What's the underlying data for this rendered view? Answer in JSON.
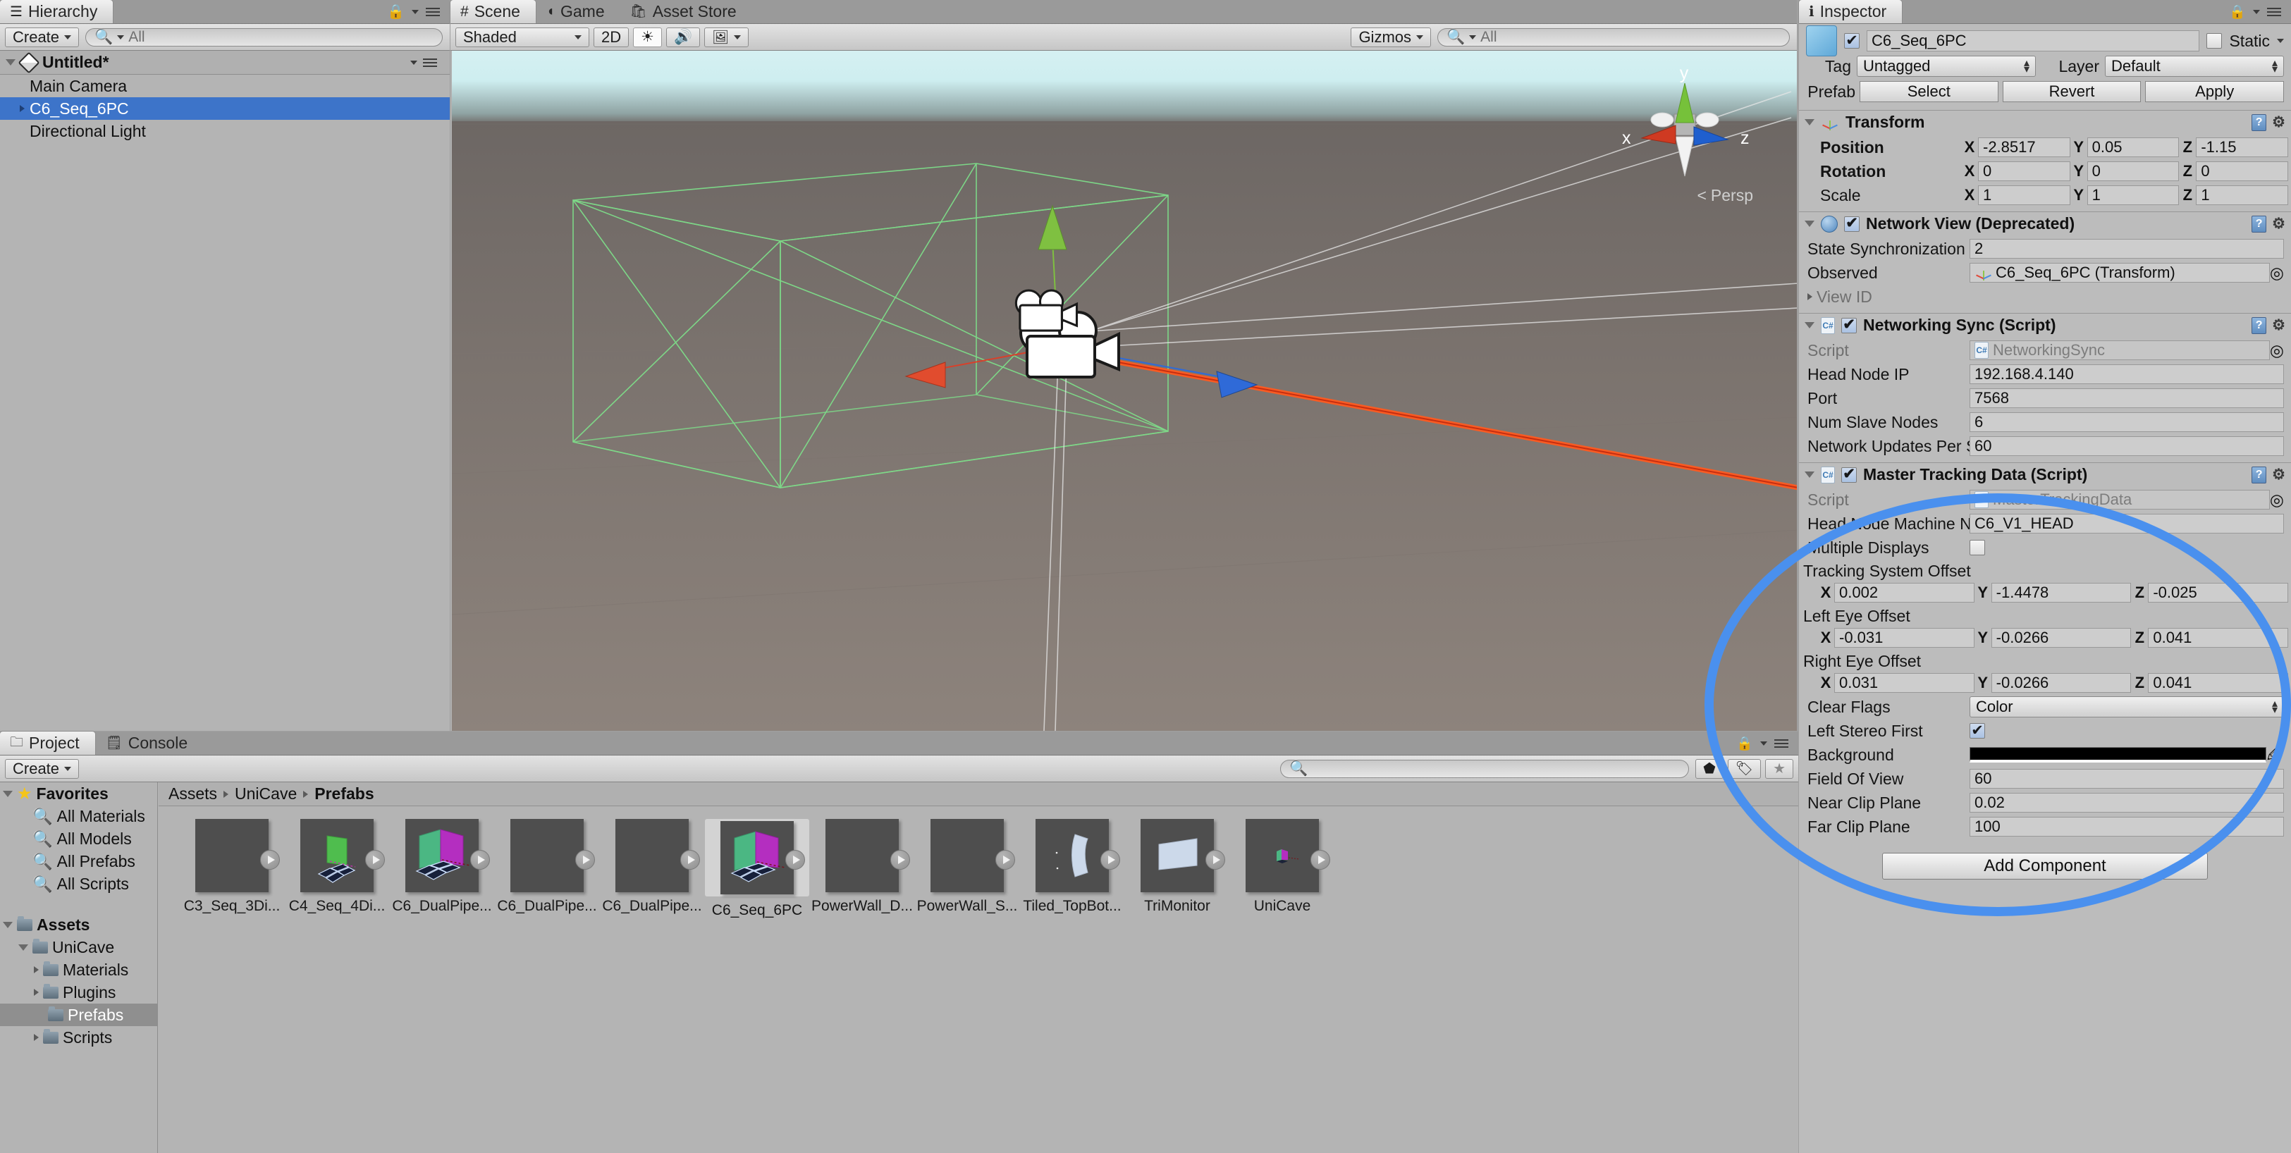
{
  "hierarchy": {
    "tab": "Hierarchy",
    "create_label": "Create",
    "search_placeholder": "All",
    "scene_name": "Untitled*",
    "items": [
      {
        "label": "Main Camera",
        "selected": false,
        "expandable": false
      },
      {
        "label": "C6_Seq_6PC",
        "selected": true,
        "expandable": true
      },
      {
        "label": "Directional Light",
        "selected": false,
        "expandable": false
      }
    ]
  },
  "sceneview": {
    "tabs": [
      {
        "label": "Scene",
        "icon": "grid-icon",
        "active": true
      },
      {
        "label": "Game",
        "icon": "gamepad-icon",
        "active": false
      },
      {
        "label": "Asset Store",
        "icon": "store-icon",
        "active": false
      }
    ],
    "draw_mode": "Shaded",
    "two_d_label": "2D",
    "lighting_icon": "sun-icon",
    "audio_icon": "speaker-icon",
    "effects_icon": "image-icon",
    "gizmos_label": "Gizmos",
    "search_placeholder": "All",
    "axis_labels": {
      "x": "x",
      "y": "y",
      "z": "z"
    },
    "projection_label": "Persp"
  },
  "project": {
    "tabs": [
      {
        "label": "Project",
        "icon": "folder-icon",
        "active": true
      },
      {
        "label": "Console",
        "icon": "console-icon",
        "active": false
      }
    ],
    "create_label": "Create",
    "search_placeholder": "",
    "breadcrumb": [
      "Assets",
      "UniCave",
      "Prefabs"
    ],
    "tree": [
      {
        "label": "Favorites",
        "icon": "star-icon",
        "depth": 0,
        "bold": true,
        "expanded": true,
        "selected": false
      },
      {
        "label": "All Materials",
        "icon": "search-icon",
        "depth": 1,
        "bold": false,
        "selected": false
      },
      {
        "label": "All Models",
        "icon": "search-icon",
        "depth": 1,
        "bold": false,
        "selected": false
      },
      {
        "label": "All Prefabs",
        "icon": "search-icon",
        "depth": 1,
        "bold": false,
        "selected": false
      },
      {
        "label": "All Scripts",
        "icon": "search-icon",
        "depth": 1,
        "bold": false,
        "selected": false
      },
      {
        "label": "",
        "icon": "",
        "depth": 0,
        "spacer": true
      },
      {
        "label": "Assets",
        "icon": "folder-icon",
        "depth": 0,
        "bold": true,
        "expanded": true,
        "selected": false
      },
      {
        "label": "UniCave",
        "icon": "folder-icon",
        "depth": 1,
        "bold": false,
        "expanded": true,
        "selected": false
      },
      {
        "label": "Materials",
        "icon": "folder-icon",
        "depth": 2,
        "bold": false,
        "expandable": true,
        "selected": false
      },
      {
        "label": "Plugins",
        "icon": "folder-icon",
        "depth": 2,
        "bold": false,
        "expandable": true,
        "selected": false
      },
      {
        "label": "Prefabs",
        "icon": "folder-icon",
        "depth": 2,
        "bold": false,
        "expandable": false,
        "selected": true
      },
      {
        "label": "Scripts",
        "icon": "folder-icon",
        "depth": 2,
        "bold": false,
        "expandable": true,
        "selected": false
      }
    ],
    "assets": [
      {
        "label": "C3_Seq_3Di...",
        "thumb": "empty",
        "selected": false
      },
      {
        "label": "C4_Seq_4Di...",
        "thumb": "green-wall",
        "selected": false
      },
      {
        "label": "C6_DualPipe...",
        "thumb": "green-magenta-cave",
        "selected": false
      },
      {
        "label": "C6_DualPipe...",
        "thumb": "empty",
        "selected": false
      },
      {
        "label": "C6_DualPipe...",
        "thumb": "empty",
        "selected": false
      },
      {
        "label": "C6_Seq_6PC",
        "thumb": "green-magenta-cave",
        "selected": true
      },
      {
        "label": "PowerWall_D...",
        "thumb": "empty",
        "selected": false
      },
      {
        "label": "PowerWall_S...",
        "thumb": "empty",
        "selected": false
      },
      {
        "label": "Tiled_TopBot...",
        "thumb": "curved-panel",
        "selected": false
      },
      {
        "label": "TriMonitor",
        "thumb": "flat-panel",
        "selected": false
      },
      {
        "label": "UniCave",
        "thumb": "small-cave",
        "selected": false
      }
    ]
  },
  "inspector": {
    "tab": "Inspector",
    "object_name": "C6_Seq_6PC",
    "object_enabled": true,
    "static_label": "Static",
    "static_checked": false,
    "tag_label": "Tag",
    "tag_value": "Untagged",
    "layer_label": "Layer",
    "layer_value": "Default",
    "prefab_label": "Prefab",
    "prefab_buttons": [
      "Select",
      "Revert",
      "Apply"
    ],
    "components": [
      {
        "name": "Transform",
        "icon": "transform-axis-icon",
        "has_checkbox": false,
        "vectors": [
          {
            "label": "Position",
            "bold": true,
            "x": "-2.8517",
            "y": "0.05",
            "z": "-1.15"
          },
          {
            "label": "Rotation",
            "bold": true,
            "x": "0",
            "y": "0",
            "z": "0"
          },
          {
            "label": "Scale",
            "bold": false,
            "x": "1",
            "y": "1",
            "z": "1"
          }
        ]
      },
      {
        "name": "Network View (Deprecated)",
        "icon": "network-globe-icon",
        "has_checkbox": true,
        "checked": true,
        "fields": [
          {
            "label": "State Synchronization",
            "value": "2",
            "type": "text"
          },
          {
            "label": "Observed",
            "value": "C6_Seq_6PC (Transform)",
            "type": "object",
            "picker": true
          },
          {
            "label": "View ID",
            "value": "",
            "type": "foldout"
          }
        ]
      },
      {
        "name": "Networking Sync (Script)",
        "icon": "csharp-script-icon",
        "has_checkbox": true,
        "checked": true,
        "fields": [
          {
            "label": "Script",
            "value": "NetworkingSync",
            "type": "script",
            "dim": true,
            "picker": true
          },
          {
            "label": "Head Node IP",
            "value": "192.168.4.140",
            "type": "text"
          },
          {
            "label": "Port",
            "value": "7568",
            "type": "text"
          },
          {
            "label": "Num Slave Nodes",
            "value": "6",
            "type": "text"
          },
          {
            "label": "Network Updates Per S",
            "value": "60",
            "type": "text"
          }
        ]
      },
      {
        "name": "Master Tracking Data (Script)",
        "icon": "csharp-script-icon",
        "has_checkbox": true,
        "checked": true,
        "highlighted": true,
        "fields": [
          {
            "label": "Script",
            "value": "MasterTrackingData",
            "type": "script",
            "dim": true,
            "picker": true
          },
          {
            "label": "Head Node Machine N",
            "value": "C6_V1_HEAD",
            "type": "text"
          },
          {
            "label": "Multiple Displays",
            "value": "",
            "type": "checkbox",
            "checked": false
          }
        ],
        "vectors": [
          {
            "label": "Tracking System Offset",
            "bold": false,
            "x": "0.002",
            "y": "-1.4478",
            "z": "-0.025"
          },
          {
            "label": "Left Eye Offset",
            "bold": false,
            "x": "-0.031",
            "y": "-0.0266",
            "z": "0.041"
          },
          {
            "label": "Right Eye Offset",
            "bold": false,
            "x": "0.031",
            "y": "-0.0266",
            "z": "0.041"
          }
        ],
        "fields2": [
          {
            "label": "Clear Flags",
            "value": "Color",
            "type": "popup"
          },
          {
            "label": "Left Stereo First",
            "value": "",
            "type": "checkbox",
            "checked": true
          },
          {
            "label": "Background",
            "value": "#000000",
            "type": "color"
          },
          {
            "label": "Field Of View",
            "value": "60",
            "type": "text"
          },
          {
            "label": "Near Clip Plane",
            "value": "0.02",
            "type": "text"
          },
          {
            "label": "Far Clip Plane",
            "value": "100",
            "type": "text"
          }
        ]
      }
    ],
    "add_component_label": "Add Component"
  },
  "colors": {
    "selection_blue": "#3d74c9",
    "highlight_ellipse": "#4a90ee",
    "panel_bg": "#bcbcbc",
    "field_bg": "#cdcdcd",
    "cave_green": "#4fad6e",
    "cave_magenta": "#b42ec0"
  }
}
